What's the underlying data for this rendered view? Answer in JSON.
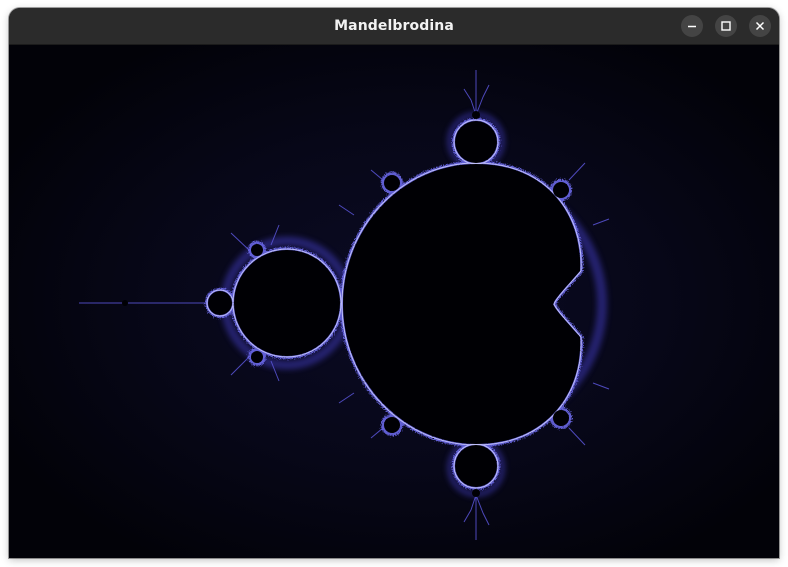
{
  "window": {
    "title": "Mandelbrodina"
  },
  "titlebar_buttons": {
    "minimize_icon": "minimize-icon",
    "maximize_icon": "maximize-icon",
    "close_icon": "close-icon"
  },
  "colors": {
    "titlebar": "#2b2b2b",
    "background": "#020208",
    "set_interior": "#000004",
    "edge_glow": "#4a46c8",
    "edge_highlight": "#c8c8ff"
  }
}
